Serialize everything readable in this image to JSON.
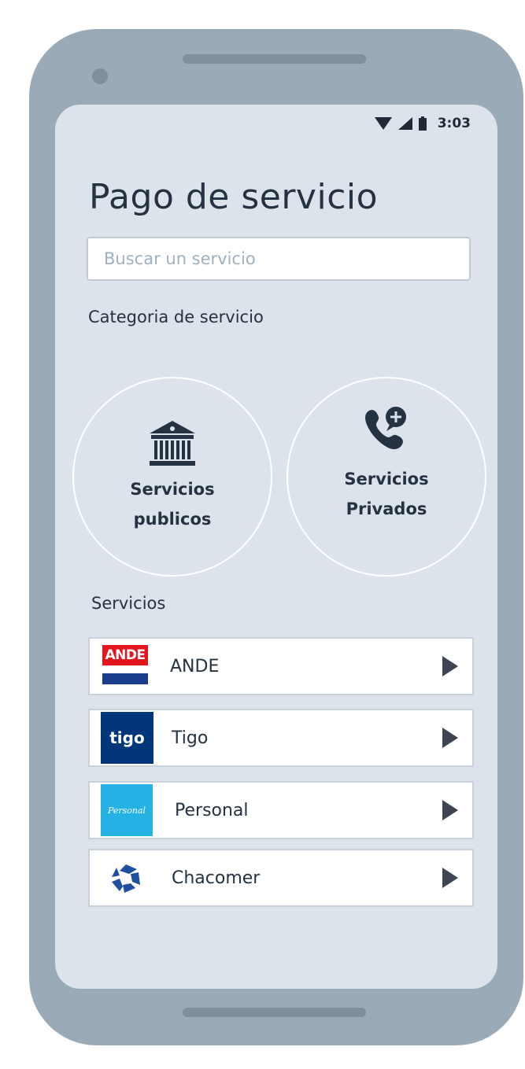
{
  "status_bar": {
    "time": "3:03"
  },
  "page": {
    "title": "Pago de servicio"
  },
  "search": {
    "placeholder": "Buscar un servicio",
    "value": ""
  },
  "categories": {
    "heading": "Categoria de servicio",
    "items": [
      {
        "line1": "Servicios",
        "line2": "publicos",
        "icon": "bank-icon"
      },
      {
        "line1": "Servicios",
        "line2": "Privados",
        "icon": "phone-add-icon"
      }
    ]
  },
  "services": {
    "heading": "Servicios",
    "items": [
      {
        "name": "ANDE",
        "logo_text": "ANDE",
        "logo": "ande-logo",
        "colors": {
          "top": "#e3161f",
          "bottom": "#1a3c8c"
        }
      },
      {
        "name": "Tigo",
        "logo_text": "tigo",
        "logo": "tigo-logo",
        "colors": {
          "bg": "#00377b"
        }
      },
      {
        "name": "Personal",
        "logo_text": "Personal",
        "logo": "personal-logo",
        "colors": {
          "bg": "#23b2e3"
        }
      },
      {
        "name": "Chacomer",
        "logo": "chacomer-logo",
        "colors": {
          "fg": "#1f4f9e"
        }
      }
    ]
  },
  "colors": {
    "phone_body": "#9aaab7",
    "screen_bg": "#dde3ea",
    "text_primary": "#243242",
    "placeholder": "#9fb0c1"
  }
}
